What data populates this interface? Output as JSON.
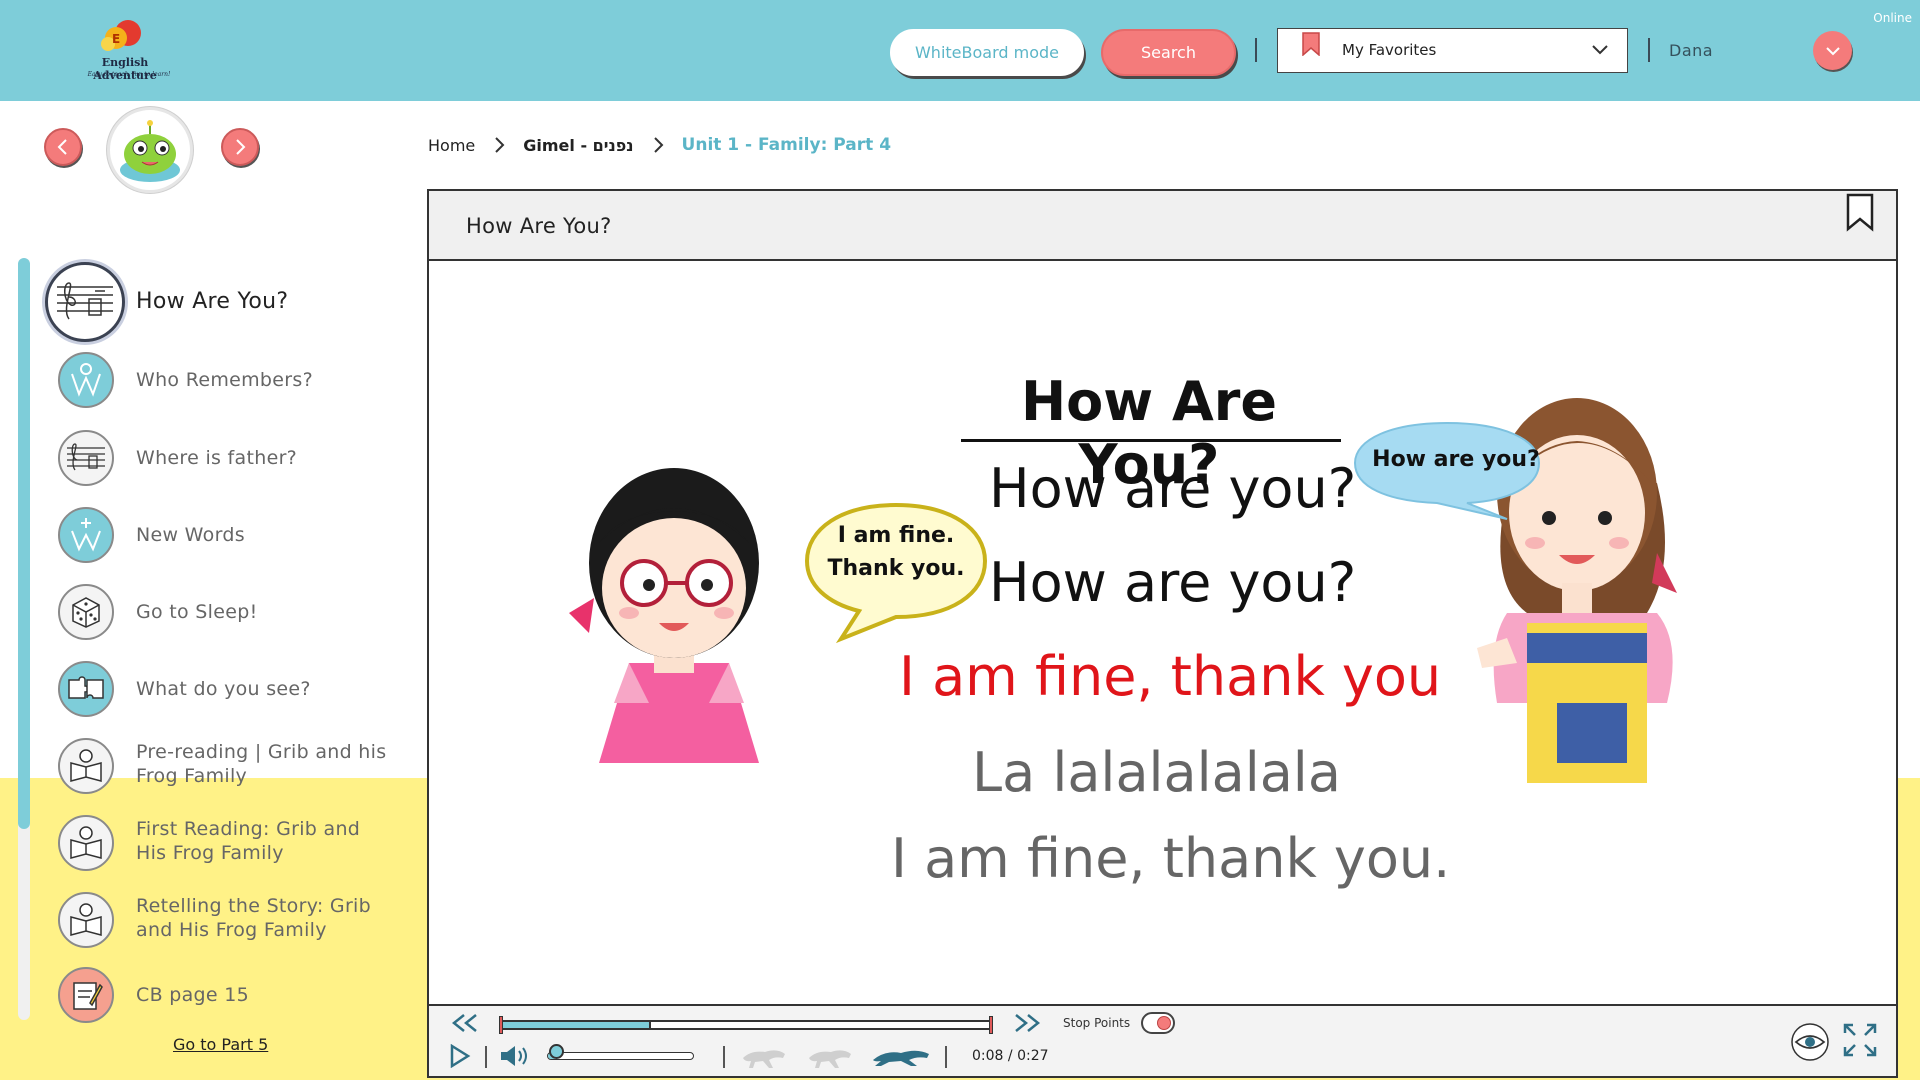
{
  "app": {
    "brand": "English Adventure",
    "tagline": "Easy to teach, fun to learn!",
    "status": "Online"
  },
  "header": {
    "whiteboard_label": "WhiteBoard mode",
    "search_label": "Search",
    "favorites_label": "My Favorites",
    "user_name": "Dana"
  },
  "breadcrumb": {
    "home": "Home",
    "level": "Gimel - נפנים",
    "current": "Unit 1 - Family: Part 4"
  },
  "sidebar": {
    "lessons": [
      {
        "label": "How Are You?",
        "icon": "music-sheet-icon",
        "active": true
      },
      {
        "label": "Who Remembers?",
        "icon": "word-refresh-icon"
      },
      {
        "label": "Where is father?",
        "icon": "music-sheet-icon"
      },
      {
        "label": "New Words",
        "icon": "word-plus-icon"
      },
      {
        "label": "Go to Sleep!",
        "icon": "dice-icon"
      },
      {
        "label": "What do you see?",
        "icon": "puzzle-icon"
      },
      {
        "label": "Pre-reading | Grib and his Frog Family",
        "icon": "reading-icon"
      },
      {
        "label": "First Reading: Grib and His Frog Family",
        "icon": "reading-icon"
      },
      {
        "label": "Retelling the Story: Grib and His Frog Family",
        "icon": "reading-icon"
      },
      {
        "label": "CB page 15",
        "icon": "workbook-icon"
      }
    ],
    "next_part": "Go to Part 5"
  },
  "player": {
    "title": "How Are You?",
    "song": {
      "title": "How Are You?",
      "line1": "How are you?",
      "line2": "How are you?",
      "line3": "I am fine, thank you",
      "line4": "La lalalalalala",
      "line5": "I am fine, thank you."
    },
    "bubble_left": [
      "I am fine.",
      "Thank you."
    ],
    "bubble_right": "How are you?",
    "controls": {
      "current_time": "0:08",
      "separator": "/",
      "duration": "0:27",
      "stop_points_label": "Stop Points",
      "stop_points_on": true,
      "progress_fraction": 0.3,
      "volume_fraction": 0.06,
      "speed_selected": "fast"
    }
  },
  "colors": {
    "header_bg": "#7ecdd9",
    "accent_coral": "#f47b7b",
    "accent_teal": "#5bb5c7",
    "band_yellow": "#fff287",
    "highlight_red": "#e0151a"
  }
}
